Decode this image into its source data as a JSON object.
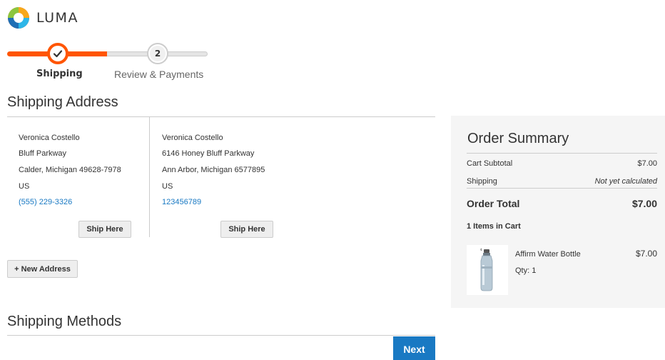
{
  "header": {
    "logo_text": "LUMA"
  },
  "progress": {
    "steps": [
      {
        "number": "1",
        "label": "Shipping",
        "state": "complete"
      },
      {
        "number": "2",
        "label": "Review & Payments",
        "state": "pending"
      }
    ],
    "accent_color": "#ff5501"
  },
  "shipping_address": {
    "title": "Shipping Address",
    "addresses": [
      {
        "name": "Veronica Costello",
        "street": "Bluff Parkway",
        "city_line": "Calder, Michigan 49628-7978",
        "country": "US",
        "phone": "(555) 229-3326",
        "button": "Ship Here"
      },
      {
        "name": "Veronica Costello",
        "street": "6146 Honey Bluff Parkway",
        "city_line": "Ann Arbor, Michigan 6577895",
        "country": "US",
        "phone": "123456789",
        "button": "Ship Here"
      }
    ],
    "new_address_button": "+ New Address"
  },
  "shipping_methods": {
    "title": "Shipping Methods",
    "next_button": "Next"
  },
  "order_summary": {
    "title": "Order Summary",
    "cart_subtotal_label": "Cart Subtotal",
    "cart_subtotal_value": "$7.00",
    "shipping_label": "Shipping",
    "shipping_value": "Not yet calculated",
    "order_total_label": "Order Total",
    "order_total_value": "$7.00",
    "items_in_cart": "1 Items in Cart",
    "items": [
      {
        "name": "Affirm Water Bottle",
        "qty_label": "Qty: 1",
        "price": "$7.00"
      }
    ]
  },
  "colors": {
    "link": "#1979c3",
    "primary_button": "#1979c3",
    "summary_bg": "#f5f5f5"
  }
}
